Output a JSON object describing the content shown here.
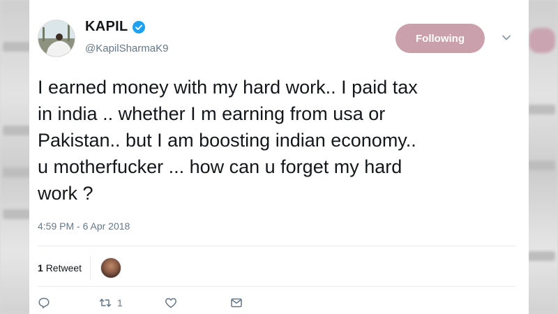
{
  "tweet": {
    "author_name": "KAPIL",
    "author_handle": "@KapilSharmaK9",
    "follow_label": "Following",
    "text": "I earned money with my hard work.. I paid tax\nin india .. whether I m earning from usa or\nPakistan.. but I am boosting indian economy..\nu motherfucker ... how can u forget my hard\nwork ?",
    "timestamp": "4:59 PM - 6 Apr 2018",
    "retweet_count": "1",
    "retweet_label": "Retweet",
    "action_retweet_count": "1"
  },
  "icons": {
    "verified": "verified-badge-icon",
    "chevron": "chevron-down-icon",
    "reply": "reply-icon",
    "retweet": "retweet-icon",
    "like": "heart-icon",
    "dm": "envelope-icon"
  },
  "colors": {
    "follow_button": "#c9a0ab",
    "verified": "#1da1f2",
    "secondary_text": "#657786",
    "primary_text": "#14171a"
  }
}
